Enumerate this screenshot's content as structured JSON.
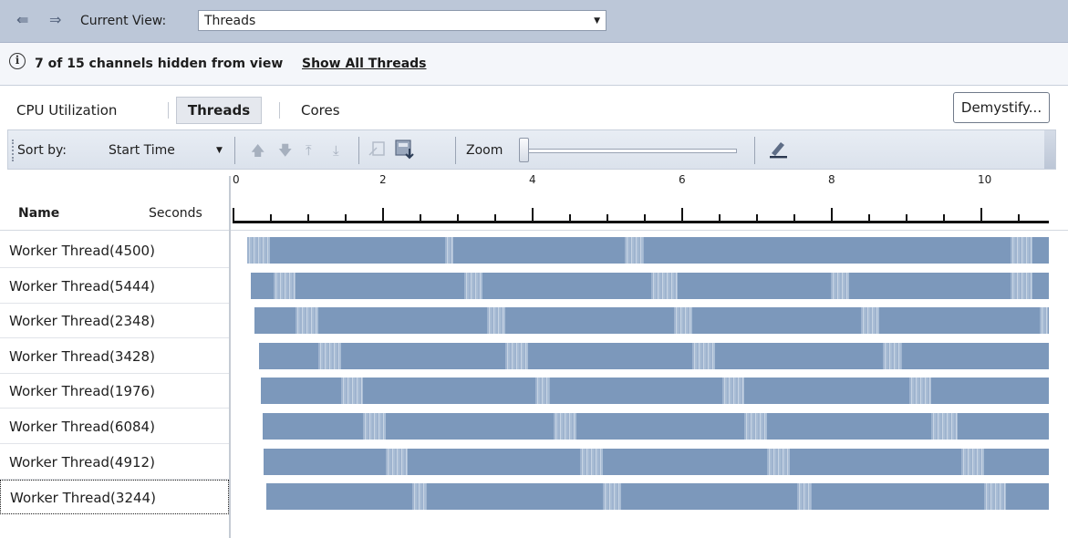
{
  "nav": {
    "back_icon": "back-arrow-icon",
    "forward_icon": "forward-arrow-icon",
    "current_view_label": "Current View:",
    "current_view_value": "Threads"
  },
  "info": {
    "icon": "info-icon",
    "message": "7 of 15  channels hidden from view",
    "link": "Show All Threads"
  },
  "tabs": {
    "items": [
      {
        "label": "CPU Utilization",
        "active": false
      },
      {
        "label": "Threads",
        "active": true
      },
      {
        "label": "Cores",
        "active": false
      }
    ],
    "demystify_label": "Demystify..."
  },
  "toolbar": {
    "sort_label": "Sort by:",
    "sort_value": "Start Time",
    "zoom_label": "Zoom",
    "zoom_level": 0
  },
  "timeline": {
    "name_header": "Name",
    "seconds_header": "Seconds",
    "tick_labels": [
      "0",
      "2",
      "4",
      "6",
      "8",
      "10"
    ]
  },
  "threads": [
    {
      "name": "Worker Thread(4500)",
      "start": 0.1,
      "busy": [
        [
          0.1,
          0.4
        ],
        [
          2.75,
          2.85
        ],
        [
          5.15,
          5.4
        ],
        [
          10.3,
          10.6
        ]
      ]
    },
    {
      "name": "Worker Thread(5444)",
      "start": 0.15,
      "busy": [
        [
          0.45,
          0.75
        ],
        [
          3.0,
          3.25
        ],
        [
          5.5,
          5.85
        ],
        [
          7.9,
          8.15
        ],
        [
          10.3,
          10.6
        ]
      ]
    },
    {
      "name": "Worker Thread(2348)",
      "start": 0.2,
      "busy": [
        [
          0.75,
          1.05
        ],
        [
          3.3,
          3.55
        ],
        [
          5.8,
          6.05
        ],
        [
          8.3,
          8.55
        ],
        [
          10.7,
          10.8
        ]
      ]
    },
    {
      "name": "Worker Thread(3428)",
      "start": 0.25,
      "busy": [
        [
          1.05,
          1.35
        ],
        [
          3.55,
          3.85
        ],
        [
          6.05,
          6.35
        ],
        [
          8.6,
          8.85
        ]
      ]
    },
    {
      "name": "Worker Thread(1976)",
      "start": 0.28,
      "busy": [
        [
          1.35,
          1.65
        ],
        [
          3.95,
          4.15
        ],
        [
          6.45,
          6.75
        ],
        [
          8.95,
          9.25
        ]
      ]
    },
    {
      "name": "Worker Thread(6084)",
      "start": 0.3,
      "busy": [
        [
          1.65,
          1.95
        ],
        [
          4.2,
          4.5
        ],
        [
          6.75,
          7.05
        ],
        [
          9.25,
          9.6
        ]
      ]
    },
    {
      "name": "Worker Thread(4912)",
      "start": 0.32,
      "busy": [
        [
          1.95,
          2.25
        ],
        [
          4.55,
          4.85
        ],
        [
          7.05,
          7.35
        ],
        [
          9.65,
          9.95
        ]
      ]
    },
    {
      "name": "Worker Thread(3244)",
      "start": 0.35,
      "busy": [
        [
          2.3,
          2.5
        ],
        [
          4.85,
          5.1
        ],
        [
          7.45,
          7.65
        ],
        [
          9.95,
          10.25
        ]
      ]
    }
  ],
  "selected_row": 7,
  "colors": {
    "bar": "#7c98bb",
    "busy": "#b4c6dc",
    "nav_bg": "#bcc7d8"
  }
}
